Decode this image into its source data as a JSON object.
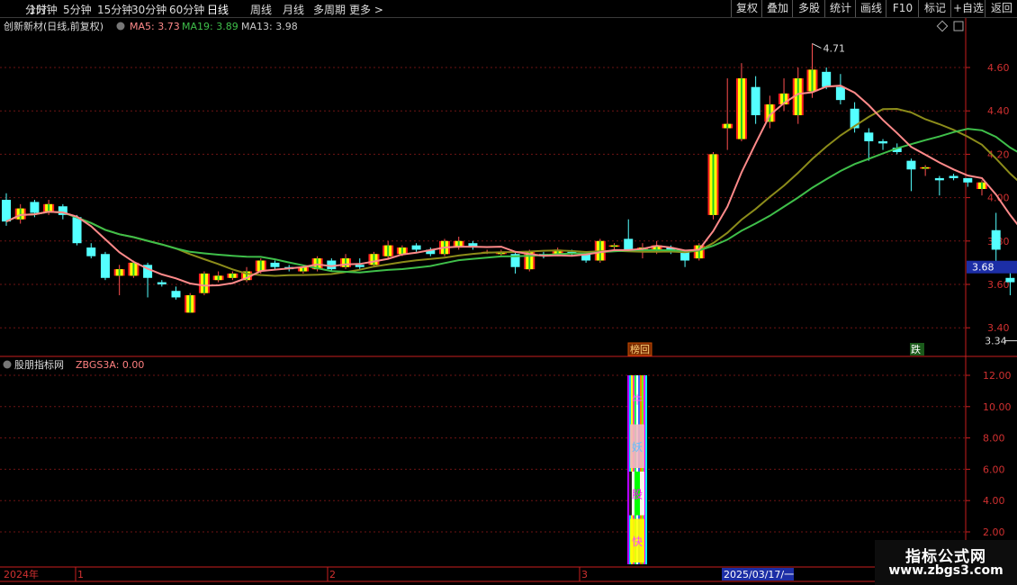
{
  "toolbar": {
    "left": [
      "分时",
      "1分钟",
      "5分钟",
      "15分钟",
      "30分钟",
      "60分钟",
      "日线",
      "周线",
      "月线",
      "多周期",
      "更多"
    ],
    "active_index": 6,
    "right": [
      "复权",
      "叠加",
      "多股",
      "统计",
      "画线",
      "F10",
      "标记",
      "+自选",
      "返回"
    ]
  },
  "main_panel": {
    "title": "创新新材(日线,前复权)",
    "ma5_label": "MA5: 3.73",
    "ma19_label": "MA19: 3.89",
    "ma13_label": "MA13: 3.98",
    "colors": {
      "ma5": "#ff8a8a",
      "ma19": "#3fbf4a",
      "ma13": "#8c8c1a",
      "up": "#ffff00",
      "down": "#54ffff"
    },
    "high_marker": "4.71",
    "low_marker": "3.34",
    "current_price": "3.68",
    "tag_bang": "榜回",
    "tag_die": "跌"
  },
  "indicator_panel": {
    "title": "股朋指标网",
    "value_label": "ZBGS3A: 0.00",
    "glyphs": [
      "牛",
      "妖",
      "股",
      "快"
    ]
  },
  "chart_data": {
    "type": "candlestick",
    "price_axis": {
      "ticks": [
        "4.60",
        "4.40",
        "4.20",
        "4.00",
        "3.80",
        "3.60",
        "3.40"
      ],
      "ylim": [
        3.26,
        4.8
      ]
    },
    "indicator_axis": {
      "ticks": [
        "12.00",
        "10.00",
        "8.00",
        "6.00",
        "4.00",
        "2.00"
      ],
      "ylim": [
        0,
        13.3
      ]
    },
    "time_axis": [
      "2024年",
      "1",
      "2",
      "3",
      "2025/03/17/一"
    ],
    "candles": [
      [
        3.99,
        3.89,
        4.02,
        3.87
      ],
      [
        3.9,
        3.95,
        3.97,
        3.88
      ],
      [
        3.98,
        3.93,
        3.99,
        3.91
      ],
      [
        3.93,
        3.97,
        3.99,
        3.92
      ],
      [
        3.96,
        3.92,
        3.97,
        3.9
      ],
      [
        3.91,
        3.79,
        3.92,
        3.78
      ],
      [
        3.77,
        3.73,
        3.79,
        3.72
      ],
      [
        3.74,
        3.63,
        3.75,
        3.62
      ],
      [
        3.64,
        3.67,
        3.69,
        3.55
      ],
      [
        3.64,
        3.7,
        3.71,
        3.63
      ],
      [
        3.69,
        3.63,
        3.7,
        3.54
      ],
      [
        3.61,
        3.6,
        3.62,
        3.59
      ],
      [
        3.57,
        3.54,
        3.59,
        3.53
      ],
      [
        3.47,
        3.55,
        3.56,
        3.47
      ],
      [
        3.56,
        3.65,
        3.66,
        3.55
      ],
      [
        3.62,
        3.64,
        3.66,
        3.61
      ],
      [
        3.63,
        3.65,
        3.66,
        3.62
      ],
      [
        3.62,
        3.66,
        3.68,
        3.61
      ],
      [
        3.66,
        3.71,
        3.72,
        3.65
      ],
      [
        3.7,
        3.68,
        3.71,
        3.67
      ],
      [
        3.68,
        3.67,
        3.69,
        3.66
      ],
      [
        3.66,
        3.68,
        3.69,
        3.65
      ],
      [
        3.67,
        3.72,
        3.73,
        3.66
      ],
      [
        3.71,
        3.67,
        3.72,
        3.66
      ],
      [
        3.68,
        3.72,
        3.74,
        3.67
      ],
      [
        3.69,
        3.68,
        3.72,
        3.67
      ],
      [
        3.69,
        3.74,
        3.75,
        3.68
      ],
      [
        3.73,
        3.78,
        3.8,
        3.72
      ],
      [
        3.74,
        3.77,
        3.78,
        3.73
      ],
      [
        3.78,
        3.76,
        3.79,
        3.75
      ],
      [
        3.76,
        3.74,
        3.77,
        3.73
      ],
      [
        3.74,
        3.8,
        3.81,
        3.73
      ],
      [
        3.77,
        3.8,
        3.82,
        3.76
      ],
      [
        3.79,
        3.77,
        3.8,
        3.76
      ],
      [
        3.75,
        3.75,
        3.76,
        3.74
      ],
      [
        3.74,
        3.75,
        3.76,
        3.73
      ],
      [
        3.74,
        3.68,
        3.75,
        3.65
      ],
      [
        3.67,
        3.75,
        3.76,
        3.66
      ],
      [
        3.74,
        3.73,
        3.75,
        3.72
      ],
      [
        3.74,
        3.76,
        3.77,
        3.73
      ],
      [
        3.75,
        3.74,
        3.76,
        3.73
      ],
      [
        3.74,
        3.71,
        3.75,
        3.7
      ],
      [
        3.71,
        3.8,
        3.81,
        3.7
      ],
      [
        3.78,
        3.78,
        3.79,
        3.76
      ],
      [
        3.81,
        3.76,
        3.9,
        3.75
      ],
      [
        3.76,
        3.77,
        3.79,
        3.72
      ],
      [
        3.76,
        3.78,
        3.8,
        3.74
      ],
      [
        3.77,
        3.76,
        3.78,
        3.74
      ],
      [
        3.75,
        3.71,
        3.76,
        3.68
      ],
      [
        3.72,
        3.78,
        3.79,
        3.71
      ],
      [
        3.92,
        4.2,
        4.21,
        3.9
      ],
      [
        4.32,
        4.34,
        4.55,
        4.22
      ],
      [
        4.27,
        4.55,
        4.62,
        4.26
      ],
      [
        4.51,
        4.38,
        4.56,
        4.34
      ],
      [
        4.35,
        4.43,
        4.47,
        4.32
      ],
      [
        4.43,
        4.48,
        4.55,
        4.4
      ],
      [
        4.38,
        4.55,
        4.6,
        4.34
      ],
      [
        4.49,
        4.59,
        4.71,
        4.46
      ],
      [
        4.58,
        4.51,
        4.6,
        4.5
      ],
      [
        4.51,
        4.45,
        4.57,
        4.43
      ],
      [
        4.41,
        4.32,
        4.44,
        4.3
      ],
      [
        4.3,
        4.26,
        4.32,
        4.17
      ],
      [
        4.26,
        4.25,
        4.27,
        4.22
      ],
      [
        4.23,
        4.21,
        4.25,
        4.2
      ],
      [
        4.17,
        4.13,
        4.18,
        4.03
      ],
      [
        4.14,
        4.14,
        4.15,
        4.1
      ],
      [
        4.09,
        4.08,
        4.1,
        4.01
      ],
      [
        4.1,
        4.09,
        4.11,
        4.08
      ],
      [
        4.09,
        4.07,
        4.09,
        4.05
      ],
      [
        4.04,
        4.07,
        4.08,
        4.01
      ],
      [
        3.85,
        3.76,
        3.93,
        3.69
      ],
      [
        3.63,
        3.61,
        3.66,
        3.55
      ],
      [
        3.54,
        3.67,
        3.67,
        3.34
      ],
      [
        3.71,
        3.68,
        3.77,
        3.66
      ]
    ],
    "indicator": {
      "bar_value": 12.0
    }
  }
}
